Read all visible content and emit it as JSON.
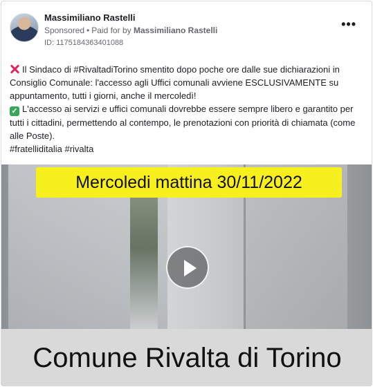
{
  "post": {
    "author": "Massimiliano Rastelli",
    "sponsored": "Sponsored",
    "paid_for_prefix": "Paid for by",
    "paid_for_by": "Massimiliano Rastelli",
    "ad_id": "ID: 1175184363401088",
    "more_label": "•••",
    "text": {
      "line1": "Il Sindaco di #RivaltadiTorino smentito dopo poche ore dalle sue dichiarazioni in Consiglio Comunale: l'accesso agli Uffici comunali avviene ESCLUSIVAMENTE su appuntamento, tutti i giorni, anche il mercoledì!",
      "line2": "L'accesso ai servizi e uffici comunali dovrebbe essere sempre libero e garantito per tutti i cittadini, permettendo al contempo, le prenotazioni con priorità di chiamata (come alle Poste).",
      "hashtags": "#fratelliditalia #rivalta"
    },
    "icons": {
      "first_line": "cross-mark-icon",
      "second_line": "check-mark-icon"
    },
    "video": {
      "top_caption": "Mercoledi mattina 30/11/2022",
      "bottom_caption": "Comune Rivalta di Torino",
      "caption_highlight": "#f7ef1e",
      "caption_bar": "#d9d9d9"
    }
  }
}
